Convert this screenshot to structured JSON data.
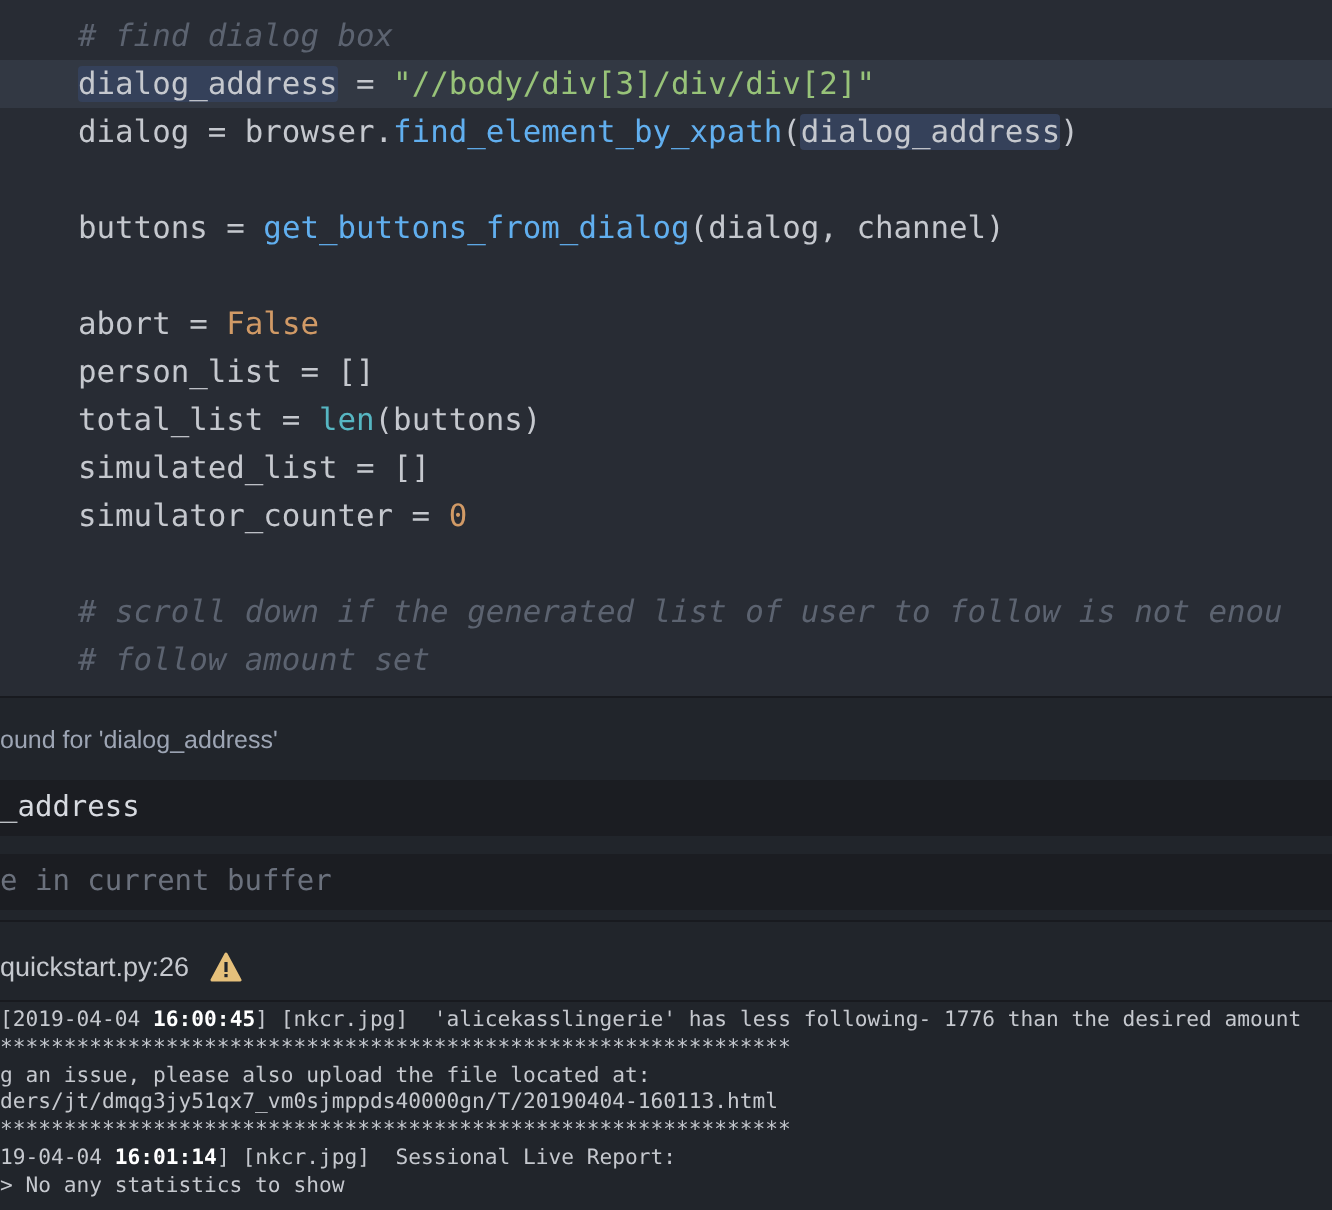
{
  "editor": {
    "lines": [
      {
        "current": false,
        "tokens": [
          {
            "kind": "comment",
            "text": "# find dialog box"
          }
        ]
      },
      {
        "current": true,
        "tokens": [
          {
            "kind": "match",
            "text": "dialog_address"
          },
          {
            "kind": "plain",
            "text": " = "
          },
          {
            "kind": "string",
            "text": "\"//body/div[3]/div/div[2]\""
          }
        ]
      },
      {
        "current": false,
        "tokens": [
          {
            "kind": "plain",
            "text": "dialog = browser."
          },
          {
            "kind": "func",
            "text": "find_element_by_xpath"
          },
          {
            "kind": "plain",
            "text": "("
          },
          {
            "kind": "match",
            "text": "dialog_address"
          },
          {
            "kind": "plain",
            "text": ")"
          }
        ]
      },
      {
        "current": false
      },
      {
        "current": false,
        "tokens": [
          {
            "kind": "plain",
            "text": "buttons = "
          },
          {
            "kind": "func",
            "text": "get_buttons_from_dialog"
          },
          {
            "kind": "plain",
            "text": "(dialog, channel)"
          }
        ]
      },
      {
        "current": false
      },
      {
        "current": false,
        "tokens": [
          {
            "kind": "plain",
            "text": "abort = "
          },
          {
            "kind": "constant",
            "text": "False"
          }
        ]
      },
      {
        "current": false,
        "tokens": [
          {
            "kind": "plain",
            "text": "person_list = []"
          }
        ]
      },
      {
        "current": false,
        "tokens": [
          {
            "kind": "plain",
            "text": "total_list = "
          },
          {
            "kind": "builtin",
            "text": "len"
          },
          {
            "kind": "plain",
            "text": "(buttons)"
          }
        ]
      },
      {
        "current": false,
        "tokens": [
          {
            "kind": "plain",
            "text": "simulated_list = []"
          }
        ]
      },
      {
        "current": false,
        "tokens": [
          {
            "kind": "plain",
            "text": "simulator_counter = "
          },
          {
            "kind": "constant",
            "text": "0"
          }
        ]
      },
      {
        "current": false
      },
      {
        "current": false,
        "tokens": [
          {
            "kind": "comment",
            "text": "# scroll down if the generated list of user to follow is not enou"
          }
        ]
      },
      {
        "current": false,
        "tokens": [
          {
            "kind": "comment",
            "text": "# follow amount set"
          }
        ]
      }
    ]
  },
  "find_panel": {
    "message": "ound for 'dialog_address'",
    "find_field": {
      "value": "_address"
    },
    "replace_field": {
      "placeholder": "e in current buffer"
    }
  },
  "console": {
    "title": "quickstart.py:26",
    "warning": true,
    "lines": [
      {
        "kind": "stamp",
        "prefix": "[2019-04-04 ",
        "time": "16:00:45",
        "rest": "] [nkcr.jpg]  'alicekasslingerie' has less following- 1776 than the desired amount"
      },
      {
        "kind": "plain",
        "text": "**************************************************************"
      },
      {
        "kind": "plain",
        "text": "g an issue, please also upload the file located at:"
      },
      {
        "kind": "plain",
        "text": "ders/jt/dmqg3jy51qx7_vm0sjmppds40000gn/T/20190404-160113.html"
      },
      {
        "kind": "plain",
        "text": "**************************************************************"
      },
      {
        "kind": "stamp",
        "prefix": "19-04-04 ",
        "time": "16:01:14",
        "rest": "] [nkcr.jpg]  Sessional Live Report:"
      },
      {
        "kind": "plain",
        "text": "> No any statistics to show"
      }
    ]
  }
}
